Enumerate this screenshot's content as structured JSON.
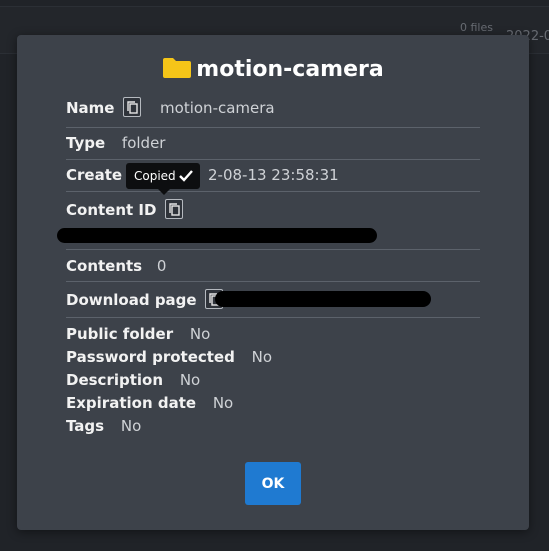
{
  "background": {
    "files_count": "0 files",
    "date_partial": "2022-0"
  },
  "dialog": {
    "title": "motion-camera",
    "tooltip": "Copied",
    "name": {
      "label": "Name",
      "value": "motion-camera"
    },
    "type": {
      "label": "Type",
      "value": "folder"
    },
    "created": {
      "label": "Create t",
      "value": "2-08-13 23:58:31"
    },
    "content_id": {
      "label": "Content ID"
    },
    "contents": {
      "label": "Contents",
      "value": "0"
    },
    "download_page": {
      "label": "Download page"
    },
    "public_folder": {
      "label": "Public folder",
      "value": "No"
    },
    "password_protected": {
      "label": "Password protected",
      "value": "No"
    },
    "description": {
      "label": "Description",
      "value": "No"
    },
    "expiration_date": {
      "label": "Expiration date",
      "value": "No"
    },
    "tags": {
      "label": "Tags",
      "value": "No"
    },
    "ok_label": "OK"
  },
  "colors": {
    "modal_bg": "#3d424a",
    "folder_icon": "#f5c518",
    "ok_button": "#1f7ad1",
    "tooltip_bg": "#0d0e10"
  }
}
